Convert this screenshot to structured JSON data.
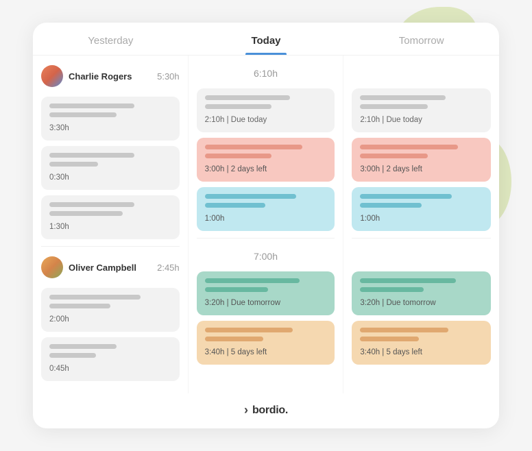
{
  "header": {
    "yesterday": "Yesterday",
    "today": "Today",
    "tomorrow": "Tomorrow"
  },
  "users": [
    {
      "name": "Charlie Rogers",
      "avatar_type": "charlie",
      "yesterday_hours": "5:30h",
      "today_hours": "6:10h",
      "yesterday_tasks": [
        {
          "label": "3:30h",
          "color": "grey"
        },
        {
          "label": "0:30h",
          "color": "grey"
        },
        {
          "label": "1:30h",
          "color": "grey"
        }
      ],
      "today_tasks": [
        {
          "label": "2:10h | Due today",
          "color": "grey"
        },
        {
          "label": "3:00h | 2 days left",
          "color": "red"
        },
        {
          "label": "1:00h",
          "color": "blue"
        }
      ],
      "tomorrow_tasks": [
        {
          "label": "2:10h | Due today",
          "color": "grey"
        },
        {
          "label": "3:00h | 2 days left",
          "color": "red"
        },
        {
          "label": "1:00h",
          "color": "blue"
        }
      ]
    },
    {
      "name": "Oliver Campbell",
      "avatar_type": "oliver",
      "yesterday_hours": "2:45h",
      "today_hours": "7:00h",
      "yesterday_tasks": [
        {
          "label": "2:00h",
          "color": "grey"
        },
        {
          "label": "0:45h",
          "color": "grey"
        }
      ],
      "today_tasks": [
        {
          "label": "3:20h | Due tomorrow",
          "color": "green"
        },
        {
          "label": "3:40h | 5 days left",
          "color": "peach"
        }
      ],
      "tomorrow_tasks": [
        {
          "label": "3:20h | Due tomorrow",
          "color": "green"
        },
        {
          "label": "3:40h | 5 days left",
          "color": "peach"
        }
      ]
    }
  ],
  "footer": {
    "logo": "bordio.",
    "icon": "›"
  }
}
